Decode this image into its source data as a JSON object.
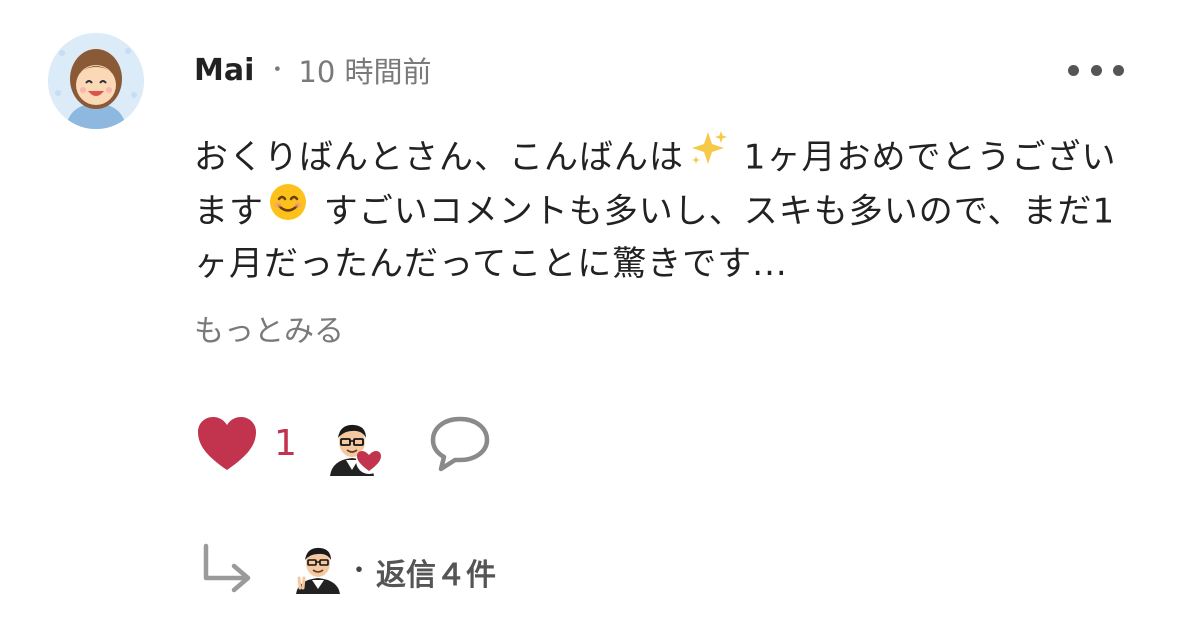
{
  "comment": {
    "author": "Mai",
    "separator": "・",
    "time": "10 時間前",
    "text_parts": {
      "p1": "おくりばんとさん、こんばんは",
      "p2": " 1ヶ月おめでとうございます",
      "p3": " すごいコメントも多いし、スキも多いので、まだ1ヶ月だったんだってことに驚きです..."
    },
    "read_more": "もっとみる"
  },
  "actions": {
    "like_count": "1"
  },
  "replies": {
    "separator": "・",
    "label": "返信４件"
  },
  "colors": {
    "heart": "#c2334d",
    "muted": "#7a7a7a",
    "avatar_bg": "#dcebf8"
  },
  "icons": {
    "more": "more-dots-icon",
    "like": "heart-icon",
    "comment": "comment-bubble-icon",
    "reply": "reply-arrow-icon",
    "sparkles": "sparkles-emoji",
    "smile": "smile-emoji"
  }
}
